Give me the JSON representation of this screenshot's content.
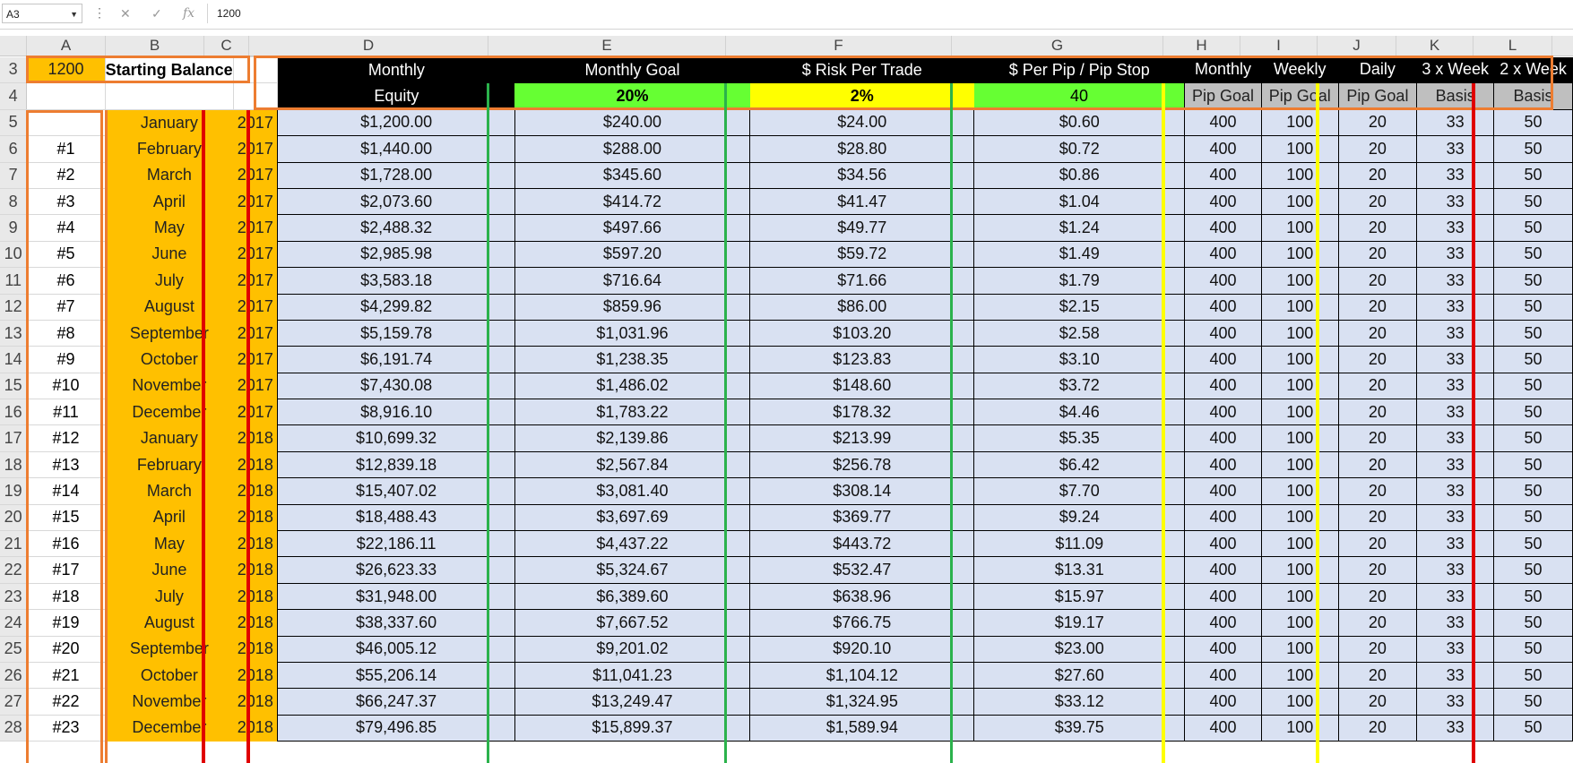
{
  "formula_bar": {
    "name_box": "A3",
    "value": "1200",
    "cancel_icon": "✕",
    "enter_icon": "✓",
    "fx_label": "fx"
  },
  "columns": [
    "A",
    "B",
    "C",
    "D",
    "E",
    "F",
    "G",
    "H",
    "I",
    "J",
    "K",
    "L"
  ],
  "row3": {
    "a": "1200",
    "b": "Starting Balance",
    "d": "Monthly",
    "e": "Monthly Goal",
    "f": "$ Risk Per Trade",
    "g": "$ Per Pip / Pip Stop",
    "h": "Monthly",
    "i": "Weekly",
    "j": "Daily",
    "k": "3 x Week",
    "l": "2 x Week"
  },
  "row4": {
    "d": "Equity",
    "e": "20%",
    "f": "2%",
    "g": "40",
    "h": "Pip Goal",
    "i": "Pip Goal",
    "j": "Pip Goal",
    "k": "Basis",
    "l": "Basis"
  },
  "rows": [
    {
      "n": "5",
      "a": "",
      "b": "January",
      "c": "2017",
      "d": "$1,200.00",
      "e": "$240.00",
      "f": "$24.00",
      "g": "$0.60",
      "h": "400",
      "i": "100",
      "j": "20",
      "k": "33",
      "l": "50"
    },
    {
      "n": "6",
      "a": "#1",
      "b": "February",
      "c": "2017",
      "d": "$1,440.00",
      "e": "$288.00",
      "f": "$28.80",
      "g": "$0.72",
      "h": "400",
      "i": "100",
      "j": "20",
      "k": "33",
      "l": "50"
    },
    {
      "n": "7",
      "a": "#2",
      "b": "March",
      "c": "2017",
      "d": "$1,728.00",
      "e": "$345.60",
      "f": "$34.56",
      "g": "$0.86",
      "h": "400",
      "i": "100",
      "j": "20",
      "k": "33",
      "l": "50"
    },
    {
      "n": "8",
      "a": "#3",
      "b": "April",
      "c": "2017",
      "d": "$2,073.60",
      "e": "$414.72",
      "f": "$41.47",
      "g": "$1.04",
      "h": "400",
      "i": "100",
      "j": "20",
      "k": "33",
      "l": "50"
    },
    {
      "n": "9",
      "a": "#4",
      "b": "May",
      "c": "2017",
      "d": "$2,488.32",
      "e": "$497.66",
      "f": "$49.77",
      "g": "$1.24",
      "h": "400",
      "i": "100",
      "j": "20",
      "k": "33",
      "l": "50"
    },
    {
      "n": "10",
      "a": "#5",
      "b": "June",
      "c": "2017",
      "d": "$2,985.98",
      "e": "$597.20",
      "f": "$59.72",
      "g": "$1.49",
      "h": "400",
      "i": "100",
      "j": "20",
      "k": "33",
      "l": "50"
    },
    {
      "n": "11",
      "a": "#6",
      "b": "July",
      "c": "2017",
      "d": "$3,583.18",
      "e": "$716.64",
      "f": "$71.66",
      "g": "$1.79",
      "h": "400",
      "i": "100",
      "j": "20",
      "k": "33",
      "l": "50"
    },
    {
      "n": "12",
      "a": "#7",
      "b": "August",
      "c": "2017",
      "d": "$4,299.82",
      "e": "$859.96",
      "f": "$86.00",
      "g": "$2.15",
      "h": "400",
      "i": "100",
      "j": "20",
      "k": "33",
      "l": "50"
    },
    {
      "n": "13",
      "a": "#8",
      "b": "September",
      "c": "2017",
      "d": "$5,159.78",
      "e": "$1,031.96",
      "f": "$103.20",
      "g": "$2.58",
      "h": "400",
      "i": "100",
      "j": "20",
      "k": "33",
      "l": "50"
    },
    {
      "n": "14",
      "a": "#9",
      "b": "October",
      "c": "2017",
      "d": "$6,191.74",
      "e": "$1,238.35",
      "f": "$123.83",
      "g": "$3.10",
      "h": "400",
      "i": "100",
      "j": "20",
      "k": "33",
      "l": "50"
    },
    {
      "n": "15",
      "a": "#10",
      "b": "November",
      "c": "2017",
      "d": "$7,430.08",
      "e": "$1,486.02",
      "f": "$148.60",
      "g": "$3.72",
      "h": "400",
      "i": "100",
      "j": "20",
      "k": "33",
      "l": "50"
    },
    {
      "n": "16",
      "a": "#11",
      "b": "December",
      "c": "2017",
      "d": "$8,916.10",
      "e": "$1,783.22",
      "f": "$178.32",
      "g": "$4.46",
      "h": "400",
      "i": "100",
      "j": "20",
      "k": "33",
      "l": "50"
    },
    {
      "n": "17",
      "a": "#12",
      "b": "January",
      "c": "2018",
      "d": "$10,699.32",
      "e": "$2,139.86",
      "f": "$213.99",
      "g": "$5.35",
      "h": "400",
      "i": "100",
      "j": "20",
      "k": "33",
      "l": "50"
    },
    {
      "n": "18",
      "a": "#13",
      "b": "February",
      "c": "2018",
      "d": "$12,839.18",
      "e": "$2,567.84",
      "f": "$256.78",
      "g": "$6.42",
      "h": "400",
      "i": "100",
      "j": "20",
      "k": "33",
      "l": "50"
    },
    {
      "n": "19",
      "a": "#14",
      "b": "March",
      "c": "2018",
      "d": "$15,407.02",
      "e": "$3,081.40",
      "f": "$308.14",
      "g": "$7.70",
      "h": "400",
      "i": "100",
      "j": "20",
      "k": "33",
      "l": "50"
    },
    {
      "n": "20",
      "a": "#15",
      "b": "April",
      "c": "2018",
      "d": "$18,488.43",
      "e": "$3,697.69",
      "f": "$369.77",
      "g": "$9.24",
      "h": "400",
      "i": "100",
      "j": "20",
      "k": "33",
      "l": "50"
    },
    {
      "n": "21",
      "a": "#16",
      "b": "May",
      "c": "2018",
      "d": "$22,186.11",
      "e": "$4,437.22",
      "f": "$443.72",
      "g": "$11.09",
      "h": "400",
      "i": "100",
      "j": "20",
      "k": "33",
      "l": "50"
    },
    {
      "n": "22",
      "a": "#17",
      "b": "June",
      "c": "2018",
      "d": "$26,623.33",
      "e": "$5,324.67",
      "f": "$532.47",
      "g": "$13.31",
      "h": "400",
      "i": "100",
      "j": "20",
      "k": "33",
      "l": "50"
    },
    {
      "n": "23",
      "a": "#18",
      "b": "July",
      "c": "2018",
      "d": "$31,948.00",
      "e": "$6,389.60",
      "f": "$638.96",
      "g": "$15.97",
      "h": "400",
      "i": "100",
      "j": "20",
      "k": "33",
      "l": "50"
    },
    {
      "n": "24",
      "a": "#19",
      "b": "August",
      "c": "2018",
      "d": "$38,337.60",
      "e": "$7,667.52",
      "f": "$766.75",
      "g": "$19.17",
      "h": "400",
      "i": "100",
      "j": "20",
      "k": "33",
      "l": "50"
    },
    {
      "n": "25",
      "a": "#20",
      "b": "September",
      "c": "2018",
      "d": "$46,005.12",
      "e": "$9,201.02",
      "f": "$920.10",
      "g": "$23.00",
      "h": "400",
      "i": "100",
      "j": "20",
      "k": "33",
      "l": "50"
    },
    {
      "n": "26",
      "a": "#21",
      "b": "October",
      "c": "2018",
      "d": "$55,206.14",
      "e": "$11,041.23",
      "f": "$1,104.12",
      "g": "$27.60",
      "h": "400",
      "i": "100",
      "j": "20",
      "k": "33",
      "l": "50"
    },
    {
      "n": "27",
      "a": "#22",
      "b": "November",
      "c": "2018",
      "d": "$66,247.37",
      "e": "$13,249.47",
      "f": "$1,324.95",
      "g": "$33.12",
      "h": "400",
      "i": "100",
      "j": "20",
      "k": "33",
      "l": "50"
    },
    {
      "n": "28",
      "a": "#23",
      "b": "December",
      "c": "2018",
      "d": "$79,496.85",
      "e": "$15,899.37",
      "f": "$1,589.94",
      "g": "$39.75",
      "h": "400",
      "i": "100",
      "j": "20",
      "k": "33",
      "l": "50"
    }
  ],
  "colors": {
    "orange": "#ffc000",
    "highlight_border": "#ed7d31",
    "green": "#66ff33",
    "yellow": "#ffff00",
    "light_blue": "#d9e1f2",
    "red": "#ff0000"
  }
}
